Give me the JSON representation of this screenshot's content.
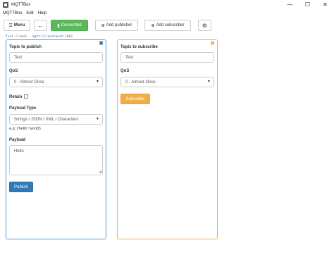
{
  "window": {
    "title": "MQTTBox",
    "minimize": "—",
    "maximize": "☐",
    "close": "✕"
  },
  "menu": [
    "MQTTBox",
    "Edit",
    "Help"
  ],
  "toolbar": {
    "menu_label": "Menu",
    "back_icon": "←",
    "connected_label": "Connected",
    "add_publisher_label": "Add publisher",
    "add_subscriber_label": "Add subscriber",
    "settings_icon": "⚙",
    "status_color": "#5cb85c"
  },
  "connection": {
    "text": "Test client - mqtt://localhost:1883"
  },
  "publisher": {
    "topic_label": "Topic to publish",
    "topic_value": "Test",
    "qos_label": "QoS",
    "qos_value": "0 - Almost Once",
    "retain_label": "Retain",
    "payload_type_label": "Payload Type",
    "payload_type_value": "Strings / JSON / XML / Characters",
    "payload_hint": "e.g: {'hello':'world'}",
    "payload_label": "Payload",
    "payload_value": "Hello",
    "publish_label": "Publish",
    "close_icon": "✖",
    "accent": "#5b9bd5"
  },
  "subscriber": {
    "topic_label": "Topic to subscribe",
    "topic_value": "Test",
    "qos_label": "QoS",
    "qos_value": "0 - Almost Once",
    "subscribe_label": "Subscribe",
    "close_icon": "✖",
    "accent": "#f0ad4e"
  }
}
